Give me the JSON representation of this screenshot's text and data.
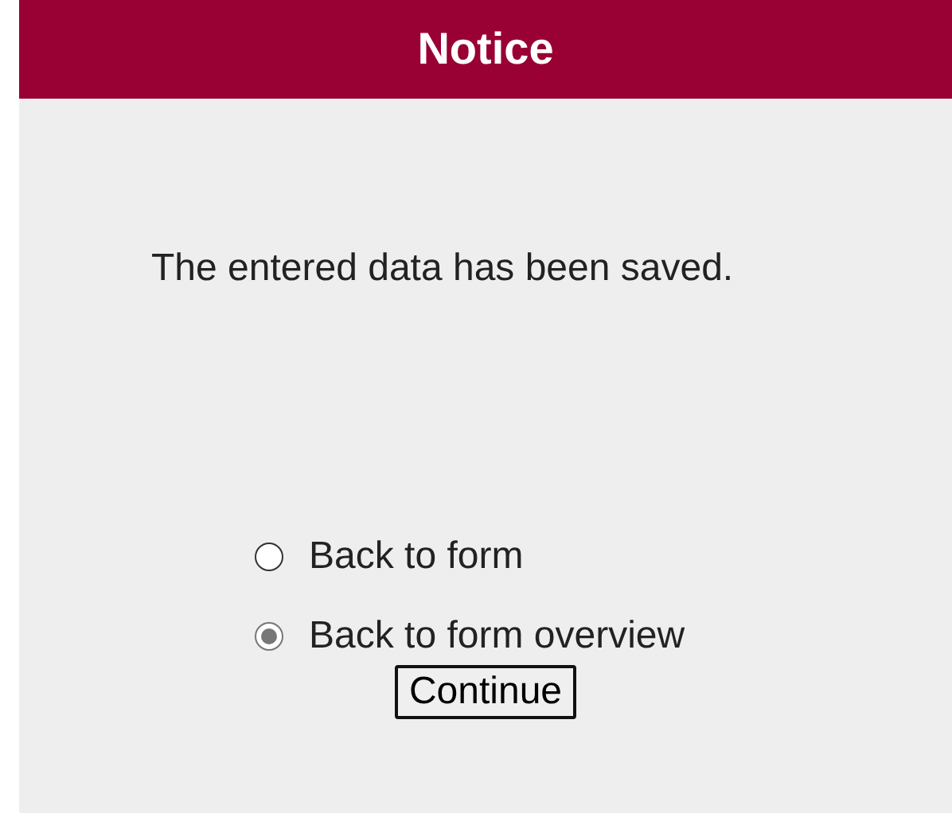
{
  "header": {
    "title": "Notice"
  },
  "message": "The entered data has been saved.",
  "options": [
    {
      "label": "Back to form",
      "selected": false
    },
    {
      "label": "Back to form overview",
      "selected": true
    }
  ],
  "button": "Continue"
}
